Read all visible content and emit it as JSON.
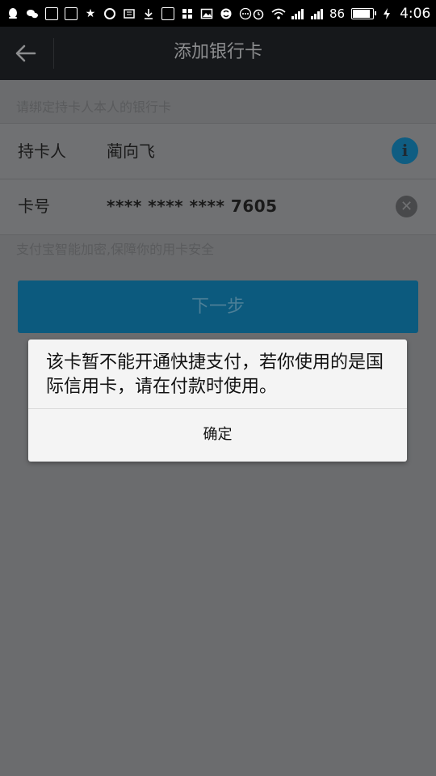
{
  "status_bar": {
    "signal_text": "86",
    "time": "4:06"
  },
  "navbar": {
    "title": "添加银行卡"
  },
  "form": {
    "hint_top": "请绑定持卡人本人的银行卡",
    "holder_label": "持卡人",
    "holder_value": "蔺向飞",
    "card_label": "卡号",
    "card_value": "**** **** **** 7605",
    "hint_bottom": "支付宝智能加密,保障你的用卡安全",
    "next_label": "下一步"
  },
  "dialog": {
    "message": "该卡暂不能开通快捷支付，若你使用的是国际信用卡，请在付款时使用。",
    "ok_label": "确定"
  },
  "colors": {
    "accent": "#0c5a7e",
    "navbar": "#16181b",
    "overlay_bg": "#6b6c6e"
  }
}
